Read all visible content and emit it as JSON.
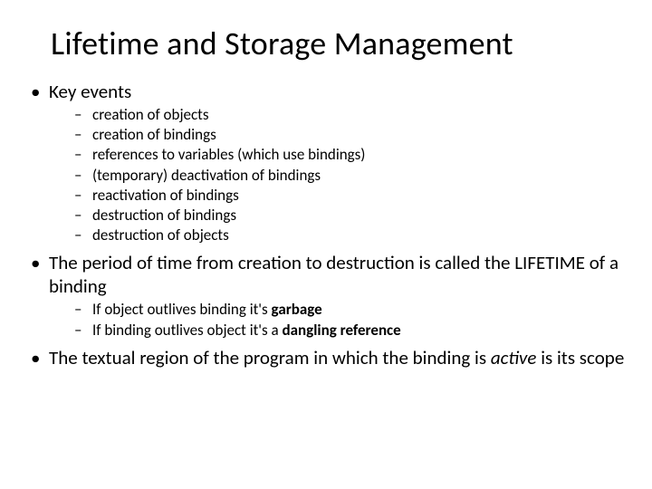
{
  "title": "Lifetime and Storage Management",
  "bullets": {
    "b1": "Key events",
    "b1_subs": [
      "creation of objects",
      "creation of bindings",
      "references to variables (which use bindings)",
      "(temporary) deactivation of bindings",
      "reactivation of bindings",
      "destruction of bindings",
      "destruction of objects"
    ],
    "b2_pre": "The period of time from creation to destruction is called the LIFETIME of a binding",
    "b2_subs": {
      "s1_pre": "If object outlives binding it's ",
      "s1_bold": "garbage",
      "s2_pre": "If binding outlives object it's a ",
      "s2_bold": "dangling reference"
    },
    "b3_pre": "The textual region of the program in which the binding is ",
    "b3_it": "active",
    "b3_post": " is its scope"
  }
}
